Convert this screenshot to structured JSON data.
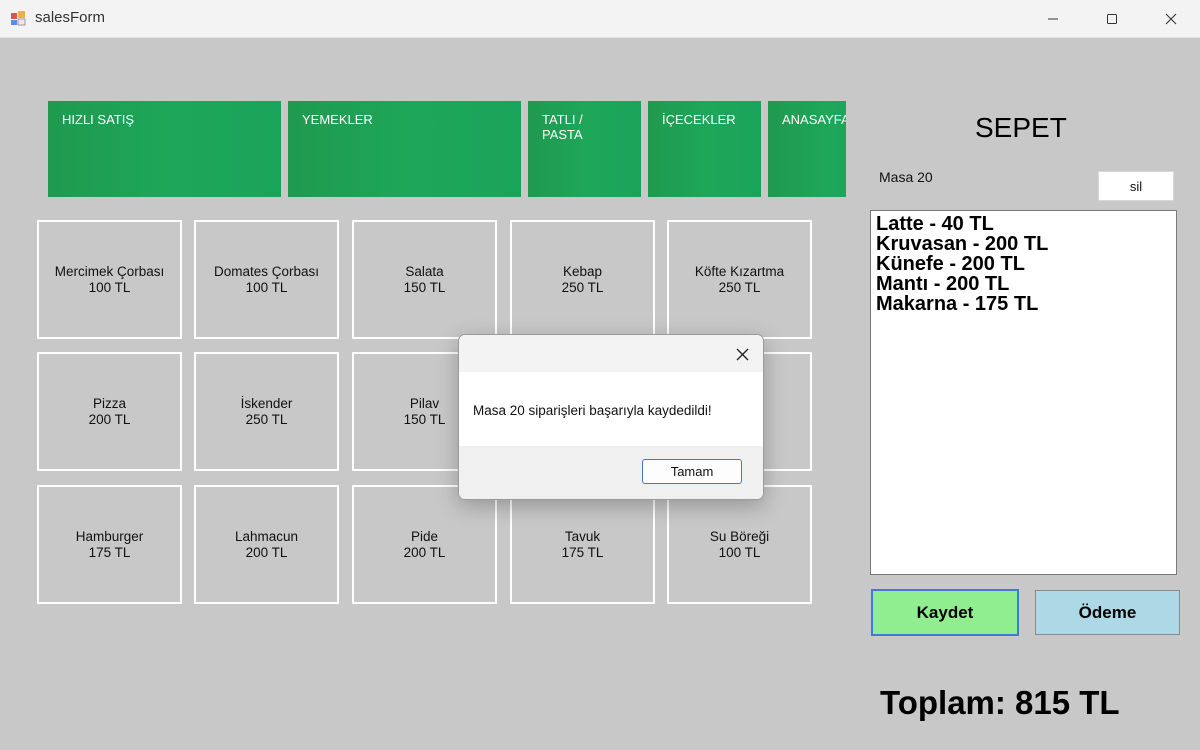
{
  "window": {
    "title": "salesForm"
  },
  "categories": [
    {
      "label": "HIZLI SATIŞ"
    },
    {
      "label": "YEMEKLER"
    },
    {
      "label": "TATLI /\nPASTA"
    },
    {
      "label": "İÇECEKLER"
    },
    {
      "label": "ANASAYFA"
    }
  ],
  "products": [
    {
      "name": "Mercimek Çorbası",
      "price": "100 TL"
    },
    {
      "name": "Domates Çorbası",
      "price": "100 TL"
    },
    {
      "name": "Salata",
      "price": "150 TL"
    },
    {
      "name": "Kebap",
      "price": "250 TL"
    },
    {
      "name": "Köfte Kızartma",
      "price": "250 TL"
    },
    {
      "name": "Pizza",
      "price": "200 TL"
    },
    {
      "name": "İskender",
      "price": "250 TL"
    },
    {
      "name": "Pilav",
      "price": "150 TL"
    },
    {
      "name": "",
      "price": ""
    },
    {
      "name": "",
      "price": ""
    },
    {
      "name": "Hamburger",
      "price": "175 TL"
    },
    {
      "name": "Lahmacun",
      "price": "200 TL"
    },
    {
      "name": "Pide",
      "price": "200 TL"
    },
    {
      "name": "Tavuk",
      "price": "175 TL"
    },
    {
      "name": "Su Böreği",
      "price": "100 TL"
    }
  ],
  "sepet": {
    "title": "SEPET",
    "table_label": "Masa 20",
    "delete_label": "sil",
    "items": [
      "Latte - 40 TL",
      "Kruvasan - 200 TL",
      "Künefe - 200 TL",
      "Mantı - 200 TL",
      "Makarna - 175 TL"
    ],
    "save_label": "Kaydet",
    "pay_label": "Ödeme",
    "total": "Toplam: 815 TL"
  },
  "dialog": {
    "message": "Masa 20 siparişleri başarıyla kaydedildi!",
    "ok_label": "Tamam"
  },
  "colors": {
    "category_green": "#1ea75a",
    "save_green": "#90ee90",
    "pay_blue": "#add8e6"
  }
}
